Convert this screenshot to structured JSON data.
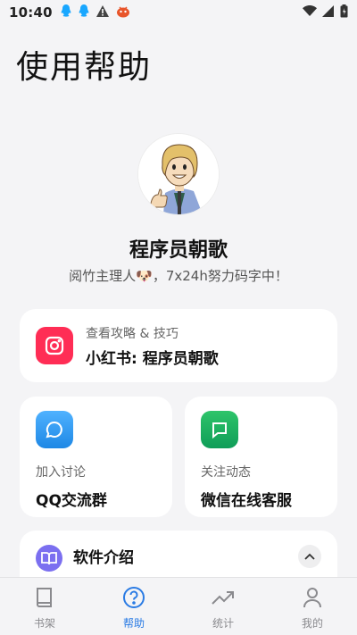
{
  "status_bar": {
    "time": "10:40",
    "notification_icons": [
      "qq-icon",
      "qq-icon",
      "warning-icon",
      "bug-icon"
    ],
    "system_icons": [
      "wifi-icon",
      "signal-icon",
      "battery-icon"
    ]
  },
  "page": {
    "title": "使用帮助"
  },
  "author": {
    "name": "程序员朝歌",
    "description": "阅竹主理人🐶，7x24h努力码字中！"
  },
  "cards": {
    "xiaohongshu": {
      "subtitle": "查看攻略 & 技巧",
      "title": "小红书: 程序员朝歌",
      "icon": "instagram-icon",
      "color": "#ff2d55"
    },
    "qq": {
      "subtitle": "加入讨论",
      "title": "QQ交流群",
      "icon": "chat-bubble-icon",
      "color": "#2196f3"
    },
    "wechat": {
      "subtitle": "关注动态",
      "title": "微信在线客服",
      "icon": "message-square-icon",
      "color": "#1aad5f"
    },
    "intro": {
      "title": "软件介绍",
      "icon": "book-icon",
      "color": "#7b6ff0",
      "toggle_icon": "chevron-up-icon"
    }
  },
  "tabbar": {
    "active_index": 1,
    "items": [
      {
        "label": "书架",
        "icon": "book-icon"
      },
      {
        "label": "帮助",
        "icon": "help-circle-icon"
      },
      {
        "label": "统计",
        "icon": "trending-up-icon"
      },
      {
        "label": "我的",
        "icon": "user-icon"
      }
    ]
  }
}
